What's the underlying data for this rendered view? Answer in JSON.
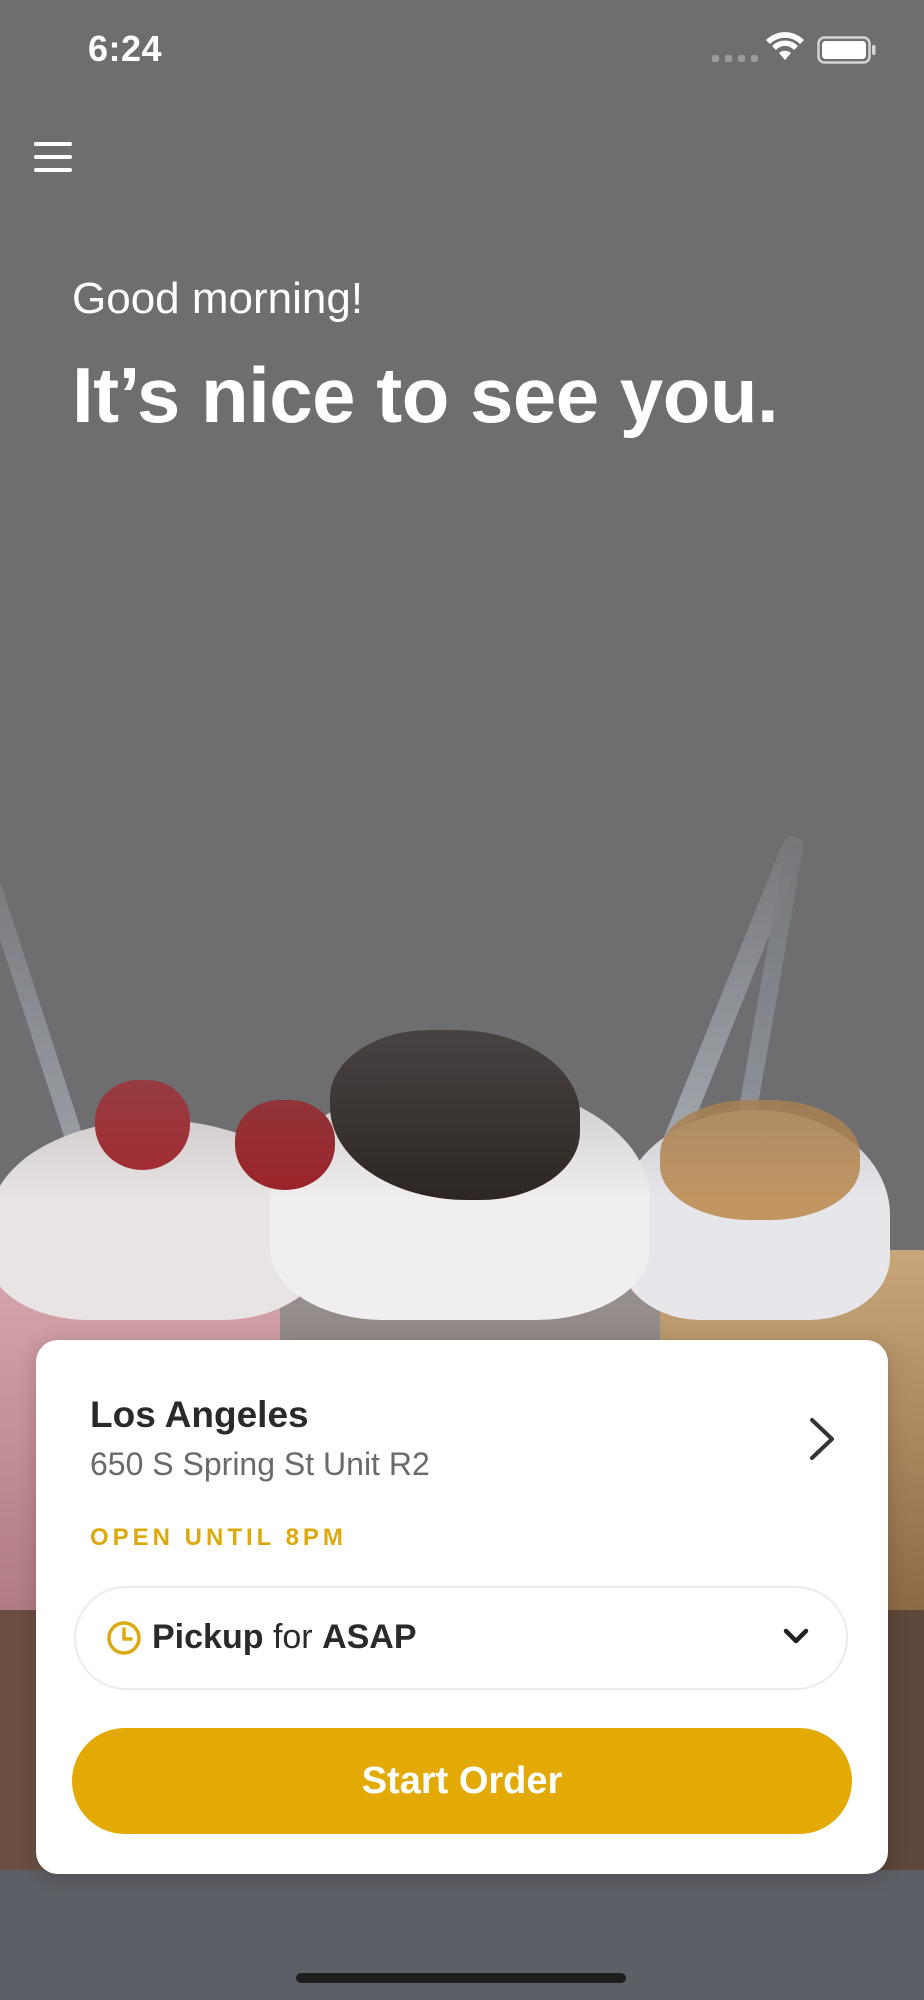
{
  "status_bar": {
    "time": "6:24"
  },
  "header": {
    "greeting": "Good morning!",
    "headline": "It’s nice to see you."
  },
  "store": {
    "name": "Los Angeles",
    "address": "650 S Spring St Unit R2",
    "hours": "OPEN UNTIL 8PM"
  },
  "order_mode": {
    "method": "Pickup",
    "connector": "for",
    "time": "ASAP"
  },
  "actions": {
    "start_order_label": "Start Order"
  },
  "colors": {
    "accent": "#e3a905",
    "hours_text": "#dcaa0e",
    "background_overlay": "#6e6e70"
  },
  "icons": {
    "menu": "menu-icon",
    "store_chevron": "chevron-right-icon",
    "clock": "clock-icon",
    "dropdown": "chevron-down-icon",
    "wifi": "wifi-icon",
    "battery": "battery-icon",
    "signal": "cellular-signal-icon"
  }
}
